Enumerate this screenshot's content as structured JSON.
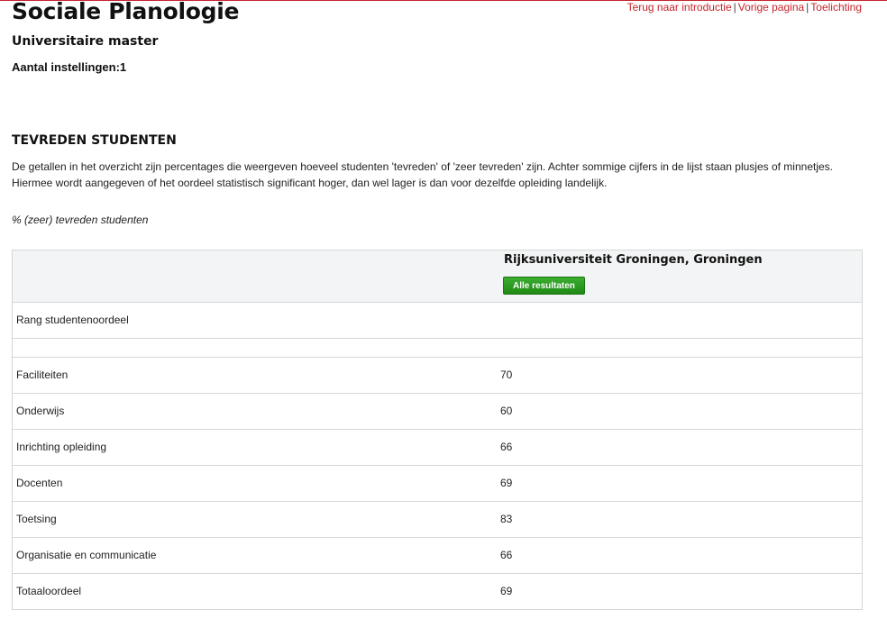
{
  "nav": {
    "links": [
      "Terug naar introductie",
      "Vorige pagina",
      "Toelichting"
    ],
    "separator": "|"
  },
  "header": {
    "title": "Sociale Planologie",
    "subtitle": "Universitaire master",
    "count": "Aantal instellingen:1"
  },
  "section": {
    "heading": "TEVREDEN STUDENTEN",
    "intro": "De getallen in het overzicht zijn percentages die weergeven hoeveel studenten 'tevreden' of 'zeer tevreden' zijn. Achter sommige cijfers in de lijst staan plusjes of minnetjes. Hiermee wordt aangegeven of het oordeel statistisch significant hoger, dan wel lager is dan voor dezelfde opleiding landelijk.",
    "caption": "% (zeer) tevreden studenten"
  },
  "table": {
    "institution": "Rijksuniversiteit Groningen, Groningen",
    "button_label": "Alle resultaten",
    "rank_label": "Rang studentenoordeel",
    "rows": [
      {
        "label": "Faciliteiten",
        "value": "70"
      },
      {
        "label": "Onderwijs",
        "value": "60"
      },
      {
        "label": "Inrichting opleiding",
        "value": "66"
      },
      {
        "label": "Docenten",
        "value": "69"
      },
      {
        "label": "Toetsing",
        "value": "83"
      },
      {
        "label": "Organisatie en communicatie",
        "value": "66"
      },
      {
        "label": "Totaaloordeel",
        "value": "69"
      }
    ]
  },
  "colors": {
    "accent": "#c5252c",
    "button": "#24921a",
    "header_bg": "#f3f4f5",
    "border": "#d6d6d6"
  }
}
